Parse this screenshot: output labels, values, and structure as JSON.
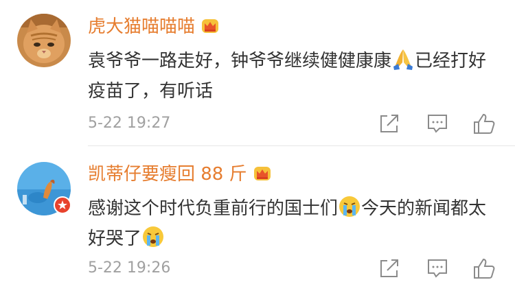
{
  "comments": [
    {
      "username": "虎大猫喵喵喵",
      "content_part1": "袁爷爷一路走好，钟爷爷继续健健康康",
      "content_part2": "已经打好疫苗了，有听话",
      "time": "5-22 19:27",
      "emoji": "pray-emoji",
      "badge": "crown-badge"
    },
    {
      "username": "凯蒂仔要瘦回 88 斤",
      "content_part1": "感谢这个时代负重前行的国士们",
      "content_part2": "今天的新闻都太好哭了",
      "time": "5-22 19:26",
      "emoji": "crying-emoji",
      "badge": "crown-badge"
    }
  ],
  "colors": {
    "username": "#e67d2f",
    "text": "#333333",
    "time": "#a0a0a0",
    "icon": "#8a8a8a",
    "divider": "#e6e6e6"
  },
  "icons": [
    "share-icon",
    "comment-icon",
    "like-icon"
  ]
}
